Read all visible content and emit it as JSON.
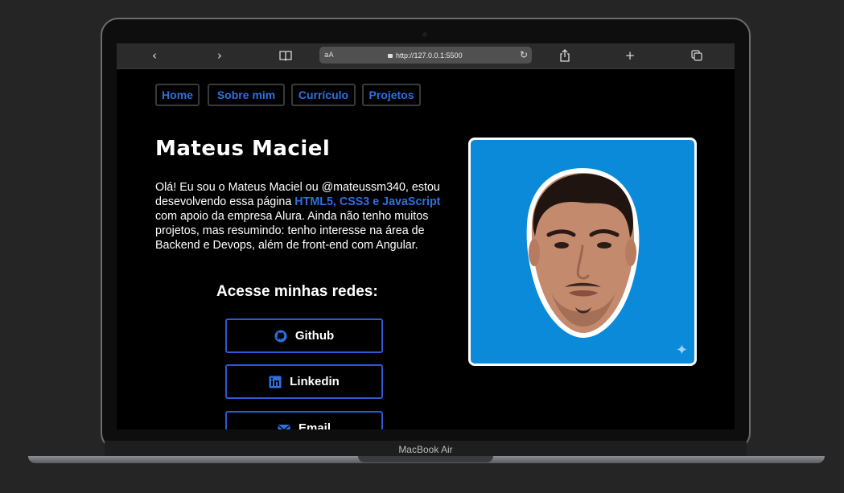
{
  "browser": {
    "address_prefix": "aA",
    "url": "http://127.0.0.1:5500",
    "icons": [
      "back-icon",
      "forward-icon",
      "book-icon",
      "lock-icon",
      "reload-icon",
      "share-icon",
      "new-tab-icon",
      "tabs-icon"
    ]
  },
  "nav": {
    "items": [
      {
        "label": "Home"
      },
      {
        "label": "Sobre mim"
      },
      {
        "label": "Currículo"
      },
      {
        "label": "Projetos"
      }
    ]
  },
  "hero": {
    "title": "Mateus Maciel",
    "intro_before": "Olá! Eu sou o Mateus Maciel ou @mateussm340, estou desevolvendo essa página ",
    "intro_highlight": "HTML5, CSS3 e JavaScript",
    "intro_after": " com apoio da empresa Alura. Ainda não tenho muitos projetos, mas resumindo: tenho interesse na área de Backend e Devops, além de front-end com Angular."
  },
  "social": {
    "heading": "Acesse minhas redes:",
    "buttons": [
      {
        "label": "Github",
        "icon": "github-icon"
      },
      {
        "label": "Linkedin",
        "icon": "linkedin-icon"
      },
      {
        "label": "Email",
        "icon": "email-icon"
      }
    ]
  },
  "colors": {
    "accent": "#2f6fe0",
    "photo_bg": "#0a8ad8",
    "page_bg": "#000000"
  },
  "device": {
    "label": "MacBook Air"
  }
}
